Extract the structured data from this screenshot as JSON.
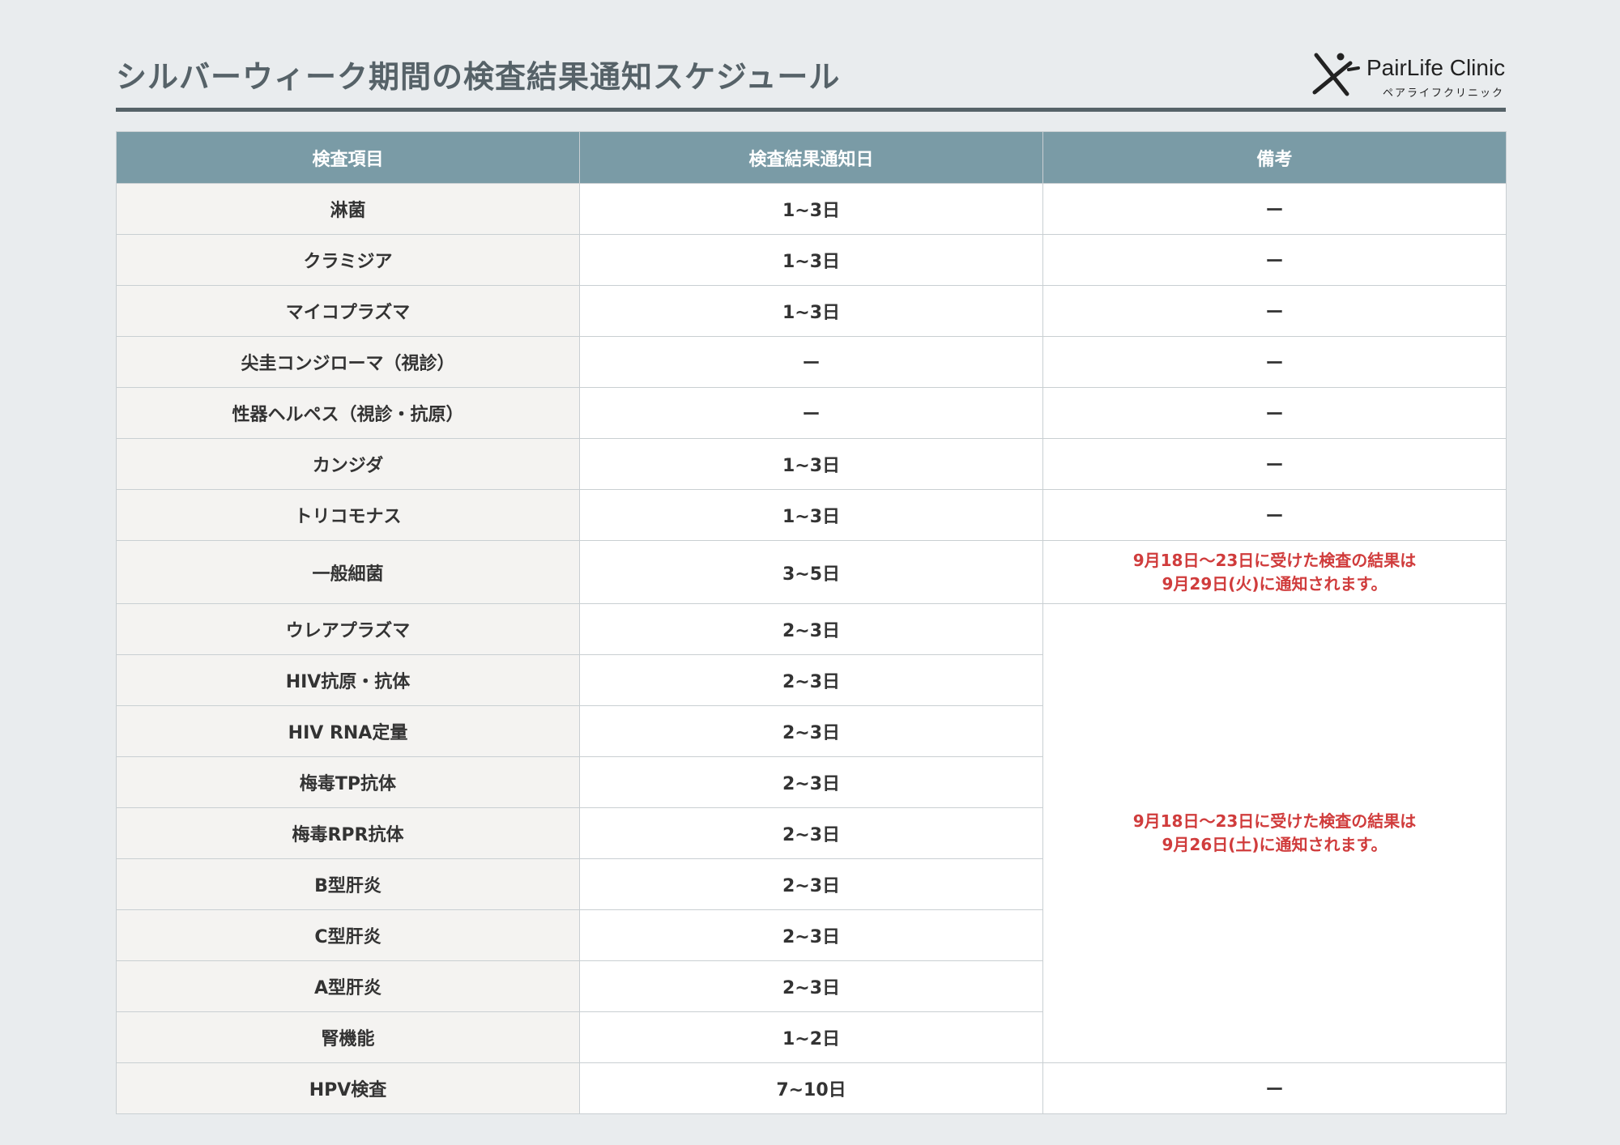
{
  "title": "シルバーウィーク期間の検査結果通知スケジュール",
  "logo": {
    "name": "PairLife Clinic",
    "subtitle": "ペアライフクリニック"
  },
  "colors": {
    "header_bg": "#7a9ba6",
    "title": "#566268",
    "note_red": "#d03c3c",
    "item_bg": "#f4f3f1"
  },
  "table": {
    "headers": [
      "検査項目",
      "検査結果通知日",
      "備考"
    ],
    "rows": [
      {
        "item": "淋菌",
        "days": "1~3日",
        "note": "ー"
      },
      {
        "item": "クラミジア",
        "days": "1~3日",
        "note": "ー"
      },
      {
        "item": "マイコプラズマ",
        "days": "1~3日",
        "note": "ー"
      },
      {
        "item": "尖圭コンジローマ（視診）",
        "days": "ー",
        "note": "ー"
      },
      {
        "item": "性器ヘルペス（視診・抗原）",
        "days": "ー",
        "note": "ー"
      },
      {
        "item": "カンジダ",
        "days": "1~3日",
        "note": "ー"
      },
      {
        "item": "トリコモナス",
        "days": "1~3日",
        "note": "ー"
      },
      {
        "item": "一般細菌",
        "days": "3~5日",
        "note_line1": "9月18日～23日に受けた検査の結果は",
        "note_line2": "9月29日(火)に通知されます。"
      },
      {
        "item": "ウレアプラズマ",
        "days": "2~3日"
      },
      {
        "item": "HIV抗原・抗体",
        "days": "2~3日"
      },
      {
        "item": "HIV RNA定量",
        "days": "2~3日"
      },
      {
        "item": "梅毒TP抗体",
        "days": "2~3日"
      },
      {
        "item": "梅毒RPR抗体",
        "days": "2~3日"
      },
      {
        "item": "B型肝炎",
        "days": "2~3日"
      },
      {
        "item": "C型肝炎",
        "days": "2~3日"
      },
      {
        "item": "A型肝炎",
        "days": "2~3日"
      },
      {
        "item": "腎機能",
        "days": "1~2日"
      },
      {
        "item": "HPV検査",
        "days": "7~10日",
        "note": "ー"
      }
    ],
    "merged_note": {
      "line1": "9月18日～23日に受けた検査の結果は",
      "line2": "9月26日(土)に通知されます。"
    }
  }
}
